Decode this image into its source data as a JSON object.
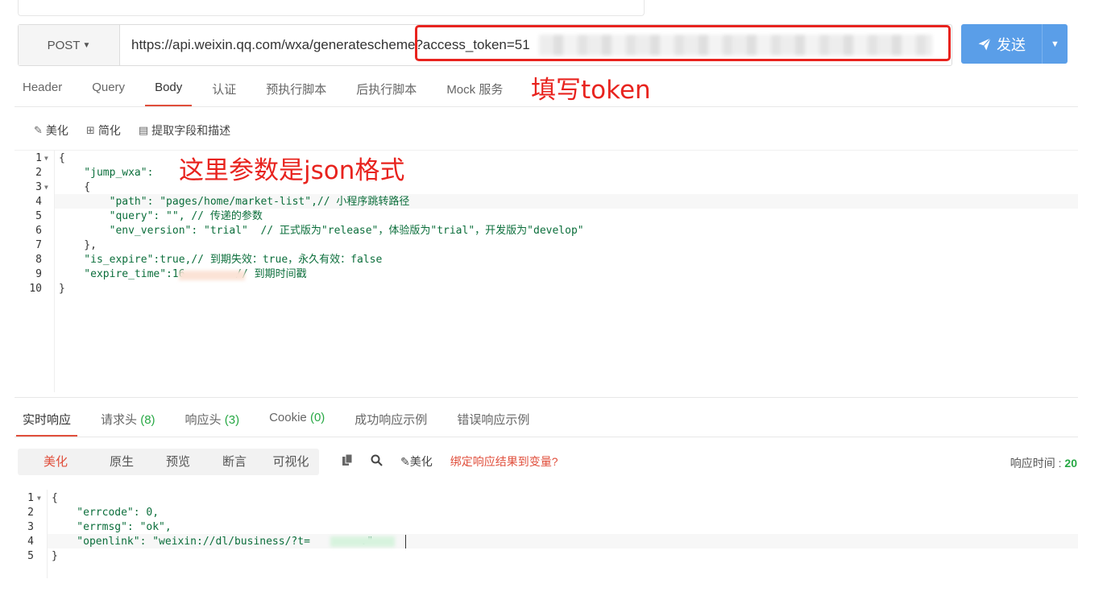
{
  "request": {
    "method": "POST",
    "url": "https://api.weixin.qq.com/wxa/generatescheme?access_token=51",
    "send_label": "发送"
  },
  "annotations": {
    "token": "填写token",
    "json_params": "这里参数是json格式"
  },
  "request_tabs": [
    "Header",
    "Query",
    "Body",
    "认证",
    "预执行脚本",
    "后执行脚本",
    "Mock 服务"
  ],
  "active_request_tab": "Body",
  "body_toolbar": {
    "beautify": "美化",
    "simplify": "简化",
    "extract": "提取字段和描述"
  },
  "body_code": {
    "line_numbers": [
      "1",
      "2",
      "3",
      "4",
      "5",
      "6",
      "7",
      "8",
      "9",
      "10"
    ],
    "lines": [
      "{",
      "    \"jump_wxa\":",
      "    {",
      "        \"path\": \"pages/home/market-list\",// 小程序跳转路径",
      "        \"query\": \"\", // 传递的参数",
      "        \"env_version\": \"trial\"  // 正式版为\"release\"，体验版为\"trial\"，开发版为\"develop\"",
      "    },",
      "    \"is_expire\":true,// 到期失效：true，永久有效：false",
      "    \"expire_time\":16        // 到期时间戳",
      "}"
    ]
  },
  "response_tabs": [
    {
      "label": "实时响应",
      "count": ""
    },
    {
      "label": "请求头",
      "count": "(8)"
    },
    {
      "label": "响应头",
      "count": "(3)"
    },
    {
      "label": "Cookie",
      "count": "(0)"
    },
    {
      "label": "成功响应示例",
      "count": ""
    },
    {
      "label": "错误响应示例",
      "count": ""
    }
  ],
  "response_view_modes": [
    "美化",
    "原生",
    "预览",
    "断言",
    "可视化"
  ],
  "response_toolbar": {
    "beautify": "美化",
    "bind_link": "绑定响应结果到变量?"
  },
  "response_time": {
    "label": "响应时间 : ",
    "value": "20"
  },
  "response_code": {
    "line_numbers": [
      "1",
      "2",
      "3",
      "4",
      "5"
    ],
    "lines": [
      "{",
      "    \"errcode\": 0,",
      "    \"errmsg\": \"ok\",",
      "    \"openlink\": \"weixin://dl/business/?t=        .\"",
      "}"
    ]
  },
  "colors": {
    "accent": "#e04e3b",
    "send_button": "#5a9ee8",
    "annotation_red": "#e8231e",
    "count_green": "#27a844"
  }
}
